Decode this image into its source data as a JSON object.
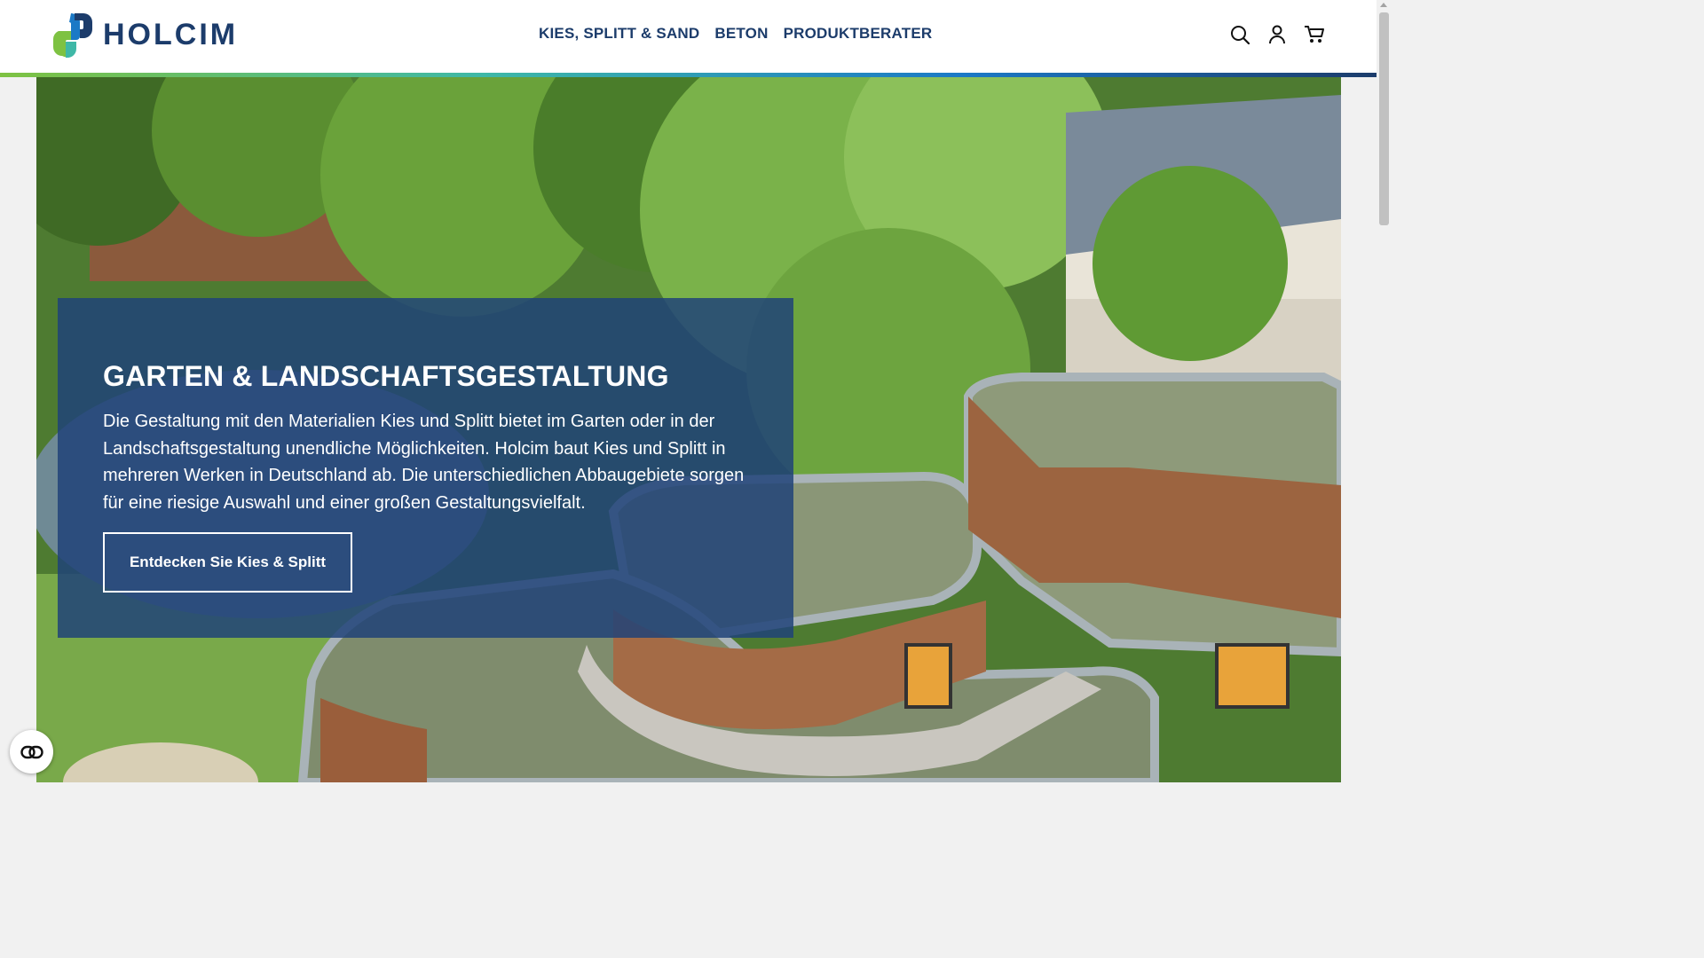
{
  "brand": {
    "name": "HOLCIM"
  },
  "nav": {
    "items": [
      {
        "label": "KIES, SPLITT & SAND"
      },
      {
        "label": "BETON"
      },
      {
        "label": "PRODUKTBERATER"
      }
    ]
  },
  "header_icons": [
    "search-icon",
    "user-icon",
    "cart-icon"
  ],
  "hero": {
    "title": "GARTEN & LANDSCHAFTSGESTALTUNG",
    "text": "Die Gestaltung mit den Materialien Kies und Splitt bietet im Garten oder in der Landschaftsgestaltung unendliche Möglichkeiten. Holcim baut Kies und Splitt in mehreren Werken in Deutschland ab. Die unterschiedlichen Abbaugebiete sorgen für eine riesige Auswahl und einer großen Gestaltungsvielfalt.",
    "cta": "Entdecken Sie Kies & Splitt"
  },
  "colors": {
    "brand_navy": "#1c3c6b",
    "overlay": "#1f4178",
    "accent_green": "#7ec242",
    "accent_blue": "#1b79c6"
  }
}
